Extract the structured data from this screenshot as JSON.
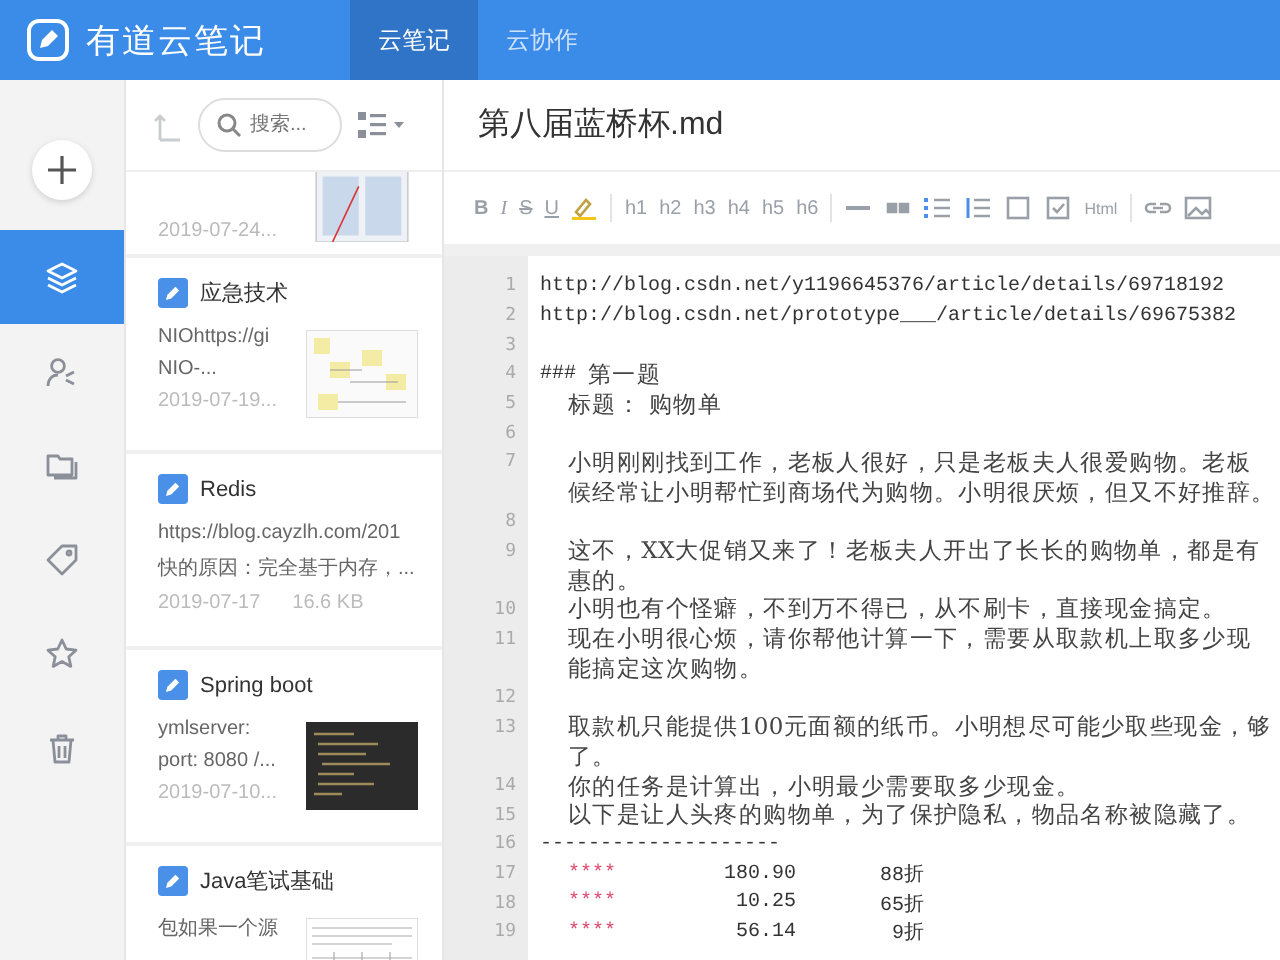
{
  "header": {
    "app_title": "有道云笔记",
    "tabs": [
      {
        "label": "云笔记",
        "selected": true
      },
      {
        "label": "云协作",
        "selected": false
      }
    ]
  },
  "rail": {
    "items": [
      {
        "kind": "layers",
        "selected": true
      },
      {
        "kind": "share",
        "selected": false
      },
      {
        "kind": "folders",
        "selected": false
      },
      {
        "kind": "tag",
        "selected": false
      },
      {
        "kind": "star",
        "selected": false
      },
      {
        "kind": "trash",
        "selected": false
      }
    ]
  },
  "note_list": {
    "search": {
      "placeholder": "搜索..."
    },
    "notes": [
      {
        "date": "2019-07-24...",
        "thumbnail": {
          "kind": "diagram"
        }
      },
      {
        "title": "应急技术",
        "snippet_lines": [
          "NIOhttps://gi",
          "NIO-..."
        ],
        "date": "2019-07-19...",
        "thumbnail": {
          "kind": "flow"
        }
      },
      {
        "title": "Redis",
        "snippet_lines": [
          "https://blog.cayzlh.com/201",
          "快的原因：完全基于内存，..."
        ],
        "date": "2019-07-17",
        "size": "16.6 KB"
      },
      {
        "title": "Spring boot",
        "snippet_lines": [
          "ymlserver:",
          "port: 8080 /..."
        ],
        "date": "2019-07-10...",
        "thumbnail": {
          "kind": "code"
        }
      },
      {
        "title": "Java笔试基础",
        "snippet_lines": [
          "包如果一个源"
        ],
        "thumbnail": {
          "kind": "table"
        }
      }
    ]
  },
  "editor": {
    "title": "第八届蓝桥杯.md",
    "toolbar": [
      {
        "kind": "bold",
        "label": "B"
      },
      {
        "kind": "italic",
        "label": "I"
      },
      {
        "kind": "strike",
        "label": "S"
      },
      {
        "kind": "underline",
        "label": "U"
      },
      {
        "kind": "highlight"
      },
      {
        "kind": "sep"
      },
      {
        "kind": "heading",
        "label": "h1"
      },
      {
        "kind": "heading",
        "label": "h2"
      },
      {
        "kind": "heading",
        "label": "h3"
      },
      {
        "kind": "heading",
        "label": "h4"
      },
      {
        "kind": "heading",
        "label": "h5"
      },
      {
        "kind": "heading",
        "label": "h6"
      },
      {
        "kind": "sep"
      },
      {
        "kind": "hr"
      },
      {
        "kind": "quote"
      },
      {
        "kind": "ul"
      },
      {
        "kind": "ol"
      },
      {
        "kind": "checkbox"
      },
      {
        "kind": "checked"
      },
      {
        "kind": "html",
        "label": "Html"
      },
      {
        "kind": "sep"
      },
      {
        "kind": "link"
      },
      {
        "kind": "image"
      }
    ],
    "lines": [
      {
        "number": "1",
        "kind": "code",
        "text": "http://blog.csdn.net/y1196645376/article/details/69718192"
      },
      {
        "number": "2",
        "kind": "code",
        "text": "http://blog.csdn.net/prototype___/article/details/69675382"
      },
      {
        "number": "3",
        "kind": "code"
      },
      {
        "number": "4",
        "kind": "heading",
        "marker": "###",
        "text": "第一题"
      },
      {
        "number": "5",
        "kind": "prose",
        "text": "标题： 购物单"
      },
      {
        "number": "6",
        "kind": "code"
      },
      {
        "number": "7",
        "kind": "prose",
        "text": "小明刚刚找到工作，老板人很好，只是老板夫人很爱购物。老板"
      },
      {
        "kind": "prose",
        "text": "候经常让小明帮忙到商场代为购物。小明很厌烦，但又不好推辞。"
      },
      {
        "number": "8",
        "kind": "code"
      },
      {
        "number": "9",
        "kind": "prose",
        "text": "这不，XX大促销又来了！老板夫人开出了长长的购物单，都是有"
      },
      {
        "kind": "prose",
        "text": "惠的。"
      },
      {
        "number": "10",
        "kind": "prose",
        "text": "小明也有个怪癖，不到万不得已，从不刷卡，直接现金搞定。"
      },
      {
        "number": "11",
        "kind": "prose",
        "text": "现在小明很心烦，请你帮他计算一下，需要从取款机上取多少现"
      },
      {
        "kind": "prose",
        "text": "能搞定这次购物。"
      },
      {
        "number": "12",
        "kind": "code"
      },
      {
        "number": "13",
        "kind": "prose",
        "text": "取款机只能提供100元面额的纸币。小明想尽可能少取些现金，够"
      },
      {
        "kind": "prose",
        "text": "了。"
      },
      {
        "number": "14",
        "kind": "prose",
        "text": "你的任务是计算出，小明最少需要取多少现金。"
      },
      {
        "number": "15",
        "kind": "prose",
        "text": "以下是让人头疼的购物单，为了保护隐私，物品名称被隐藏了。"
      },
      {
        "number": "16",
        "kind": "code",
        "text": "    --------------------"
      },
      {
        "number": "17",
        "kind": "item",
        "mark": "****",
        "price": "180.90",
        "discount": "88折"
      },
      {
        "number": "18",
        "kind": "item",
        "mark": "****",
        "price": "10.25",
        "discount": "65折"
      },
      {
        "number": "19",
        "kind": "item",
        "mark": "****",
        "price": "56.14",
        "discount": "9折"
      }
    ]
  }
}
